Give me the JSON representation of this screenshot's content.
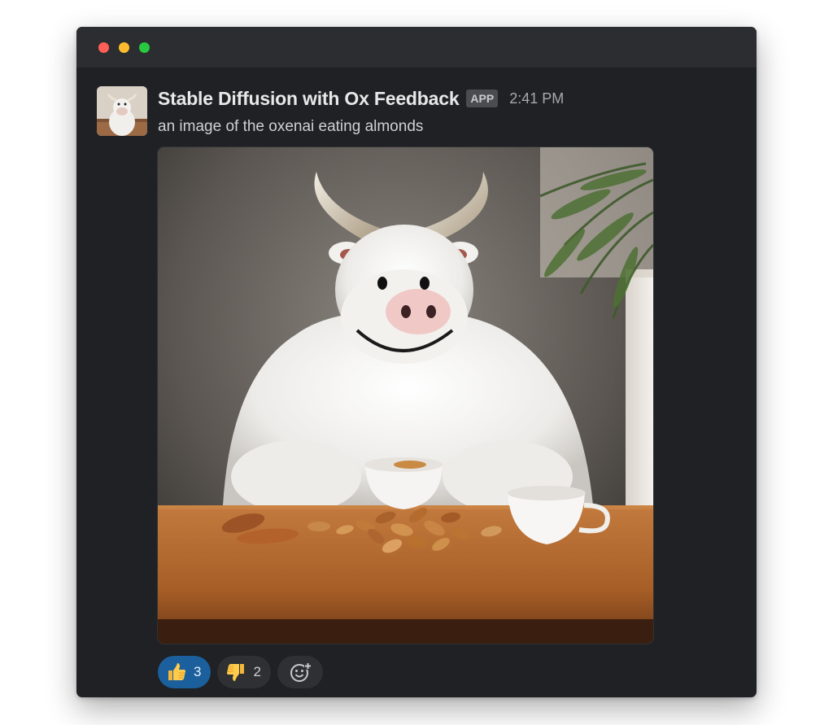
{
  "window": {
    "controls": [
      "close",
      "minimize",
      "zoom"
    ]
  },
  "message": {
    "sender": "Stable Diffusion with Ox Feedback",
    "badge": "APP",
    "timestamp": "2:41 PM",
    "text": "an image of the oxenai eating almonds",
    "attachment": {
      "type": "image",
      "subject": "white furry ox with horns at a wooden table with almonds, a bowl and a cup"
    },
    "reactions": [
      {
        "icon": "thumbs-up-icon",
        "count": "3",
        "active": true
      },
      {
        "icon": "thumbs-down-icon",
        "count": "2",
        "active": false
      }
    ],
    "add_reaction_icon": "add-reaction-icon"
  },
  "colors": {
    "window_bg": "#1f2124",
    "titlebar_bg": "#2c2d30",
    "active_reaction": "#1b5f9c",
    "reaction_bg": "#2e3033"
  }
}
